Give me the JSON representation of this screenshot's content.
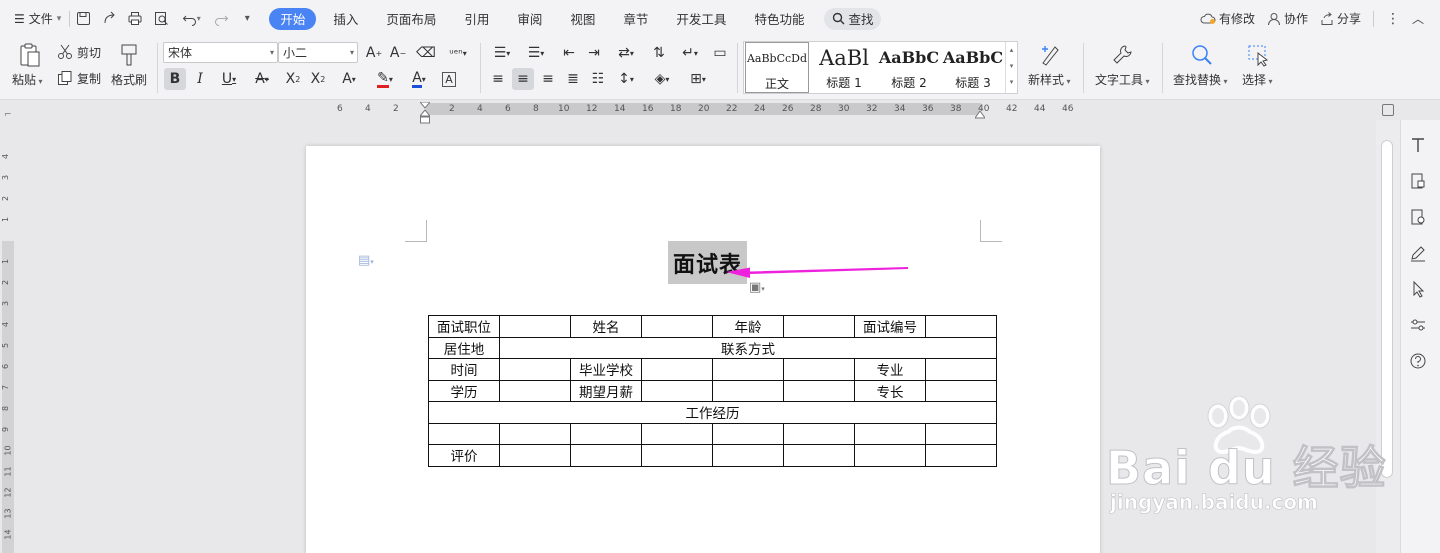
{
  "menubar": {
    "file_label": "文件",
    "tabs": [
      "开始",
      "插入",
      "页面布局",
      "引用",
      "审阅",
      "视图",
      "章节",
      "开发工具",
      "特色功能"
    ],
    "active_tab": "开始",
    "search_label": "查找",
    "right": {
      "modified": "有修改",
      "collab": "协作",
      "share": "分享"
    }
  },
  "ribbon": {
    "paste": "粘贴",
    "cut": "剪切",
    "copy": "复制",
    "format_painter": "格式刷",
    "font_name": "宋体",
    "font_size": "小二",
    "styles": [
      {
        "preview": "AaBbCcDd",
        "name": "正文"
      },
      {
        "preview": "AaBl",
        "name": "标题 1"
      },
      {
        "preview": "AaBbC",
        "name": "标题 2"
      },
      {
        "preview": "AaBbC",
        "name": "标题 3"
      }
    ],
    "new_style": "新样式",
    "text_tools": "文字工具",
    "find_replace": "查找替换",
    "select": "选择"
  },
  "ruler": {
    "h_labels": [
      "6",
      "4",
      "2",
      "2",
      "4",
      "6",
      "8",
      "10",
      "12",
      "14",
      "16",
      "18",
      "20",
      "22",
      "24",
      "26",
      "28",
      "30",
      "32",
      "34",
      "36",
      "38",
      "40",
      "42",
      "44",
      "46"
    ],
    "v_labels": [
      "4",
      "3",
      "2",
      "1",
      "1",
      "2",
      "3",
      "4",
      "5",
      "6",
      "7",
      "8",
      "9",
      "10",
      "11",
      "12",
      "13",
      "14"
    ]
  },
  "document": {
    "title": "面试表",
    "rows": [
      [
        "面试职位",
        "",
        "姓名",
        "",
        "年龄",
        "",
        "面试编号",
        ""
      ],
      [
        "居住地",
        "",
        "联系方式"
      ],
      [
        "时间",
        "",
        "毕业学校",
        "",
        "",
        "",
        "专业",
        ""
      ],
      [
        "学历",
        "",
        "期望月薪",
        "",
        "",
        "",
        "专长",
        ""
      ],
      [
        "工作经历"
      ],
      [
        "",
        "",
        "",
        "",
        "",
        "",
        "",
        ""
      ],
      [
        "评价",
        "",
        "",
        "",
        "",
        "",
        "",
        ""
      ]
    ]
  },
  "watermark": {
    "brand": "Bai du 经验",
    "url": "jingyan.baidu.com"
  },
  "colors": {
    "accent": "#4a84f4",
    "arrow": "#ee22dd",
    "font_red": "#e02020",
    "font_blue": "#1d4ed8"
  }
}
